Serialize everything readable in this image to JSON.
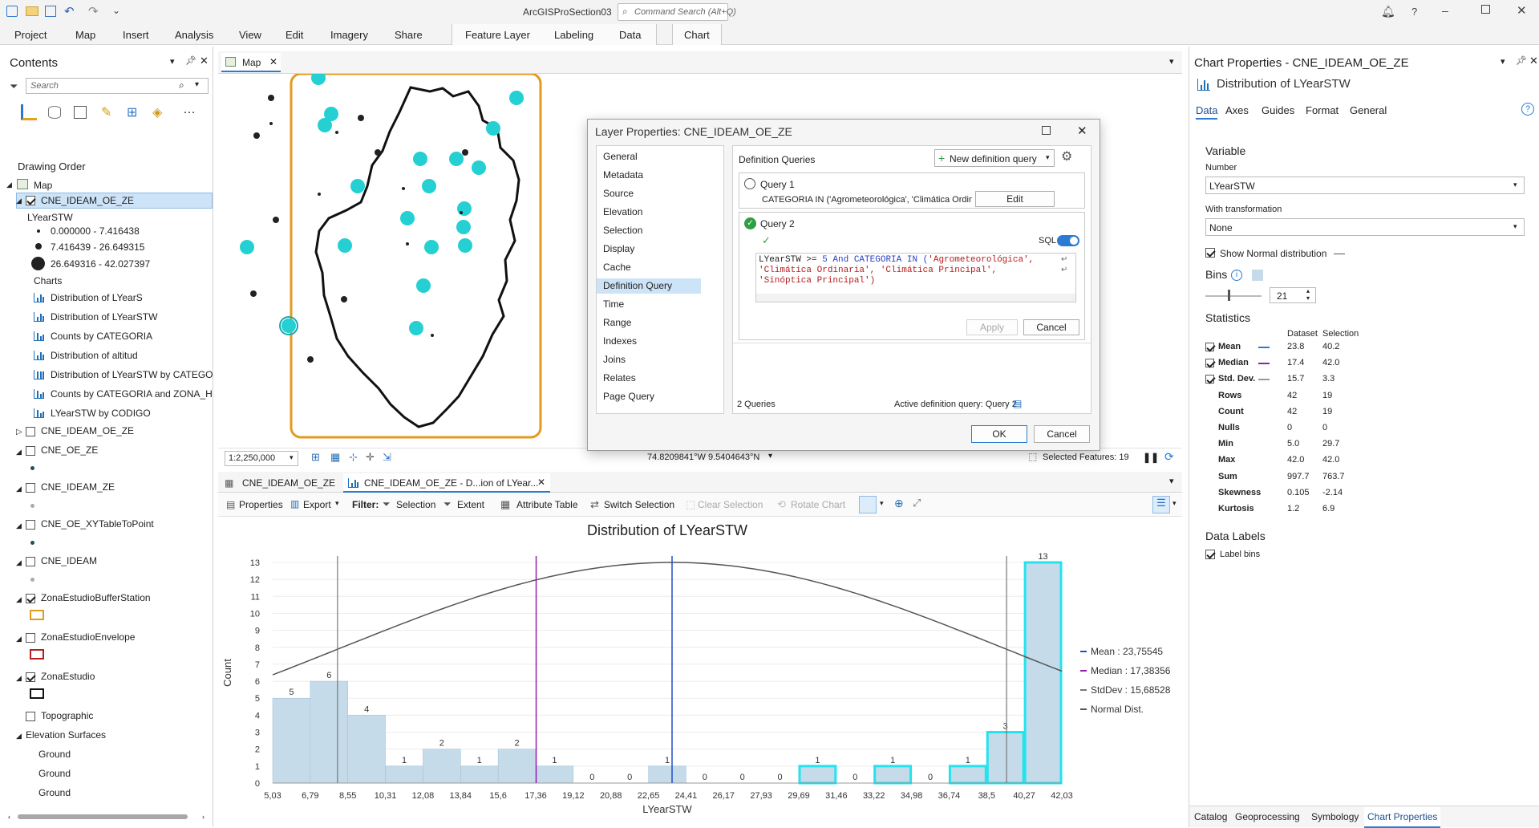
{
  "app": {
    "title": "ArcGISProSection03",
    "search_placeholder": "Command Search (Alt+Q)"
  },
  "ribbon": {
    "tabs": [
      "Project",
      "Map",
      "Insert",
      "Analysis",
      "View",
      "Edit",
      "Imagery",
      "Share"
    ],
    "context_tabs": [
      "Feature Layer",
      "Labeling",
      "Data"
    ],
    "chart_tab": "Chart"
  },
  "contents": {
    "title": "Contents",
    "search_placeholder": "Search",
    "drawing_order": "Drawing Order",
    "map": "Map",
    "layer": "CNE_IDEAM_OE_ZE",
    "field": "LYearSTW",
    "classes": [
      "0.000000 - 7.416438",
      "7.416439 - 26.649315",
      "26.649316 - 42.027397"
    ],
    "charts_label": "Charts",
    "charts": [
      "Distribution of LYearS",
      "Distribution of LYearSTW",
      "Counts by CATEGORIA",
      "Distribution of altitud",
      "Distribution of LYearSTW by CATEGOR",
      "Counts by CATEGORIA and ZONA_HI",
      "LYearSTW by CODIGO"
    ],
    "layers": [
      "CNE_IDEAM_OE_ZE",
      "CNE_OE_ZE",
      "CNE_IDEAM_ZE",
      "CNE_OE_XYTableToPoint",
      "CNE_IDEAM",
      "ZonaEstudioBufferStation",
      "ZonaEstudioEnvelope",
      "ZonaEstudio",
      "Topographic"
    ],
    "elevation": "Elevation Surfaces",
    "ground": [
      "Ground",
      "Ground",
      "Ground"
    ]
  },
  "map_view": {
    "tab": "Map",
    "scale": "1:2,250,000",
    "coords": "74.8209841°W 9.5404643°N",
    "selected": "Selected Features: 19"
  },
  "dialog": {
    "title": "Layer Properties: CNE_IDEAM_OE_ZE",
    "nav": [
      "General",
      "Metadata",
      "Source",
      "Elevation",
      "Selection",
      "Display",
      "Cache",
      "Definition Query",
      "Time",
      "Range",
      "Indexes",
      "Joins",
      "Relates",
      "Page Query"
    ],
    "section": "Definition Queries",
    "new_query": "New definition query",
    "q1": "Query 1",
    "q1_text": "CATEGORIA IN ('Agrometeorológica', 'Climática Ordinaria',...",
    "edit": "Edit",
    "q2": "Query 2",
    "sql": "SQL",
    "sql_l1a": "LYearSTW >= ",
    "sql_l1b": "5",
    "sql_l1c": " And CATEGORIA IN (",
    "sql_l1d": "'Agrometeorológica',",
    "sql_l2": "'Climática Ordinaria', 'Climática Principal',",
    "sql_l3": "'Sinóptica Principal')",
    "apply": "Apply",
    "cancel": "Cancel",
    "count": "2 Queries",
    "active": "Active definition query: Query 2",
    "ok": "OK",
    "cancel2": "Cancel"
  },
  "bottom": {
    "tabs": [
      "CNE_IDEAM_OE_ZE",
      "CNE_IDEAM_OE_ZE - D...ion of LYear..."
    ],
    "toolbar": {
      "properties": "Properties",
      "export": "Export",
      "filter": "Filter:",
      "selection": "Selection",
      "extent": "Extent",
      "attribute_table": "Attribute Table",
      "switch_selection": "Switch Selection",
      "clear_selection": "Clear Selection",
      "rotate_chart": "Rotate Chart"
    }
  },
  "chart_data": {
    "type": "bar",
    "title": "Distribution of LYearSTW",
    "xlabel": "LYearSTW",
    "ylabel": "Count",
    "bin_edges": [
      "5,03",
      "6,79",
      "8,55",
      "10,31",
      "12,08",
      "13,84",
      "15,6",
      "17,36",
      "19,12",
      "20,88",
      "22,65",
      "24,41",
      "26,17",
      "27,93",
      "29,69",
      "31,46",
      "33,22",
      "34,98",
      "36,74",
      "38,5",
      "40,27",
      "42,03"
    ],
    "values": [
      5,
      6,
      4,
      1,
      2,
      1,
      2,
      1,
      0,
      0,
      1,
      0,
      0,
      0,
      1,
      0,
      1,
      0,
      1,
      3,
      13
    ],
    "selected": [
      0,
      0,
      0,
      0,
      0,
      0,
      0,
      0,
      0,
      0,
      0,
      0,
      0,
      0,
      1,
      0,
      1,
      0,
      1,
      3,
      13
    ],
    "ylim": [
      0,
      13
    ],
    "yticks": [
      "0",
      "1",
      "2",
      "3",
      "4",
      "5",
      "6",
      "7",
      "8",
      "9",
      "10",
      "11",
      "12",
      "13"
    ],
    "mean": 23.75545,
    "median": 17.38356,
    "stddev": 15.68528,
    "legend": [
      "Mean : 23,75545",
      "Median : 17,38356",
      "StdDev : 15,68528",
      "Normal Dist."
    ],
    "colors": {
      "bar": "#c5dbe9",
      "selected_edge": "#22e3ee",
      "mean": "#1f4fc8",
      "median": "#9b1bb3",
      "std": "#777777",
      "normal": "#555555"
    }
  },
  "chart_props": {
    "title": "Chart Properties - CNE_IDEAM_OE_ZE",
    "subtitle": "Distribution of LYearSTW",
    "tabs": [
      "Data",
      "Axes",
      "Guides",
      "Format",
      "General"
    ],
    "variable": "Variable",
    "number": "Number",
    "number_val": "LYearSTW",
    "transform": "With transformation",
    "transform_val": "None",
    "show_normal": "Show Normal distribution",
    "bins": "Bins",
    "bins_val": "21",
    "statistics": "Statistics",
    "col_dataset": "Dataset",
    "col_selection": "Selection",
    "stats": [
      [
        "Mean",
        "23.8",
        "40.2"
      ],
      [
        "Median",
        "17.4",
        "42.0"
      ],
      [
        "Std. Dev.",
        "15.7",
        "3.3"
      ],
      [
        "Rows",
        "42",
        "19"
      ],
      [
        "Count",
        "42",
        "19"
      ],
      [
        "Nulls",
        "0",
        "0"
      ],
      [
        "Min",
        "5.0",
        "29.7"
      ],
      [
        "Max",
        "42.0",
        "42.0"
      ],
      [
        "Sum",
        "997.7",
        "763.7"
      ],
      [
        "Skewness",
        "0.105",
        "-2.14"
      ],
      [
        "Kurtosis",
        "1.2",
        "6.9"
      ]
    ],
    "data_labels": "Data Labels",
    "label_bins": "Label bins"
  },
  "bottom_tabs": [
    "Catalog",
    "Geoprocessing",
    "Symbology",
    "Chart Properties"
  ]
}
